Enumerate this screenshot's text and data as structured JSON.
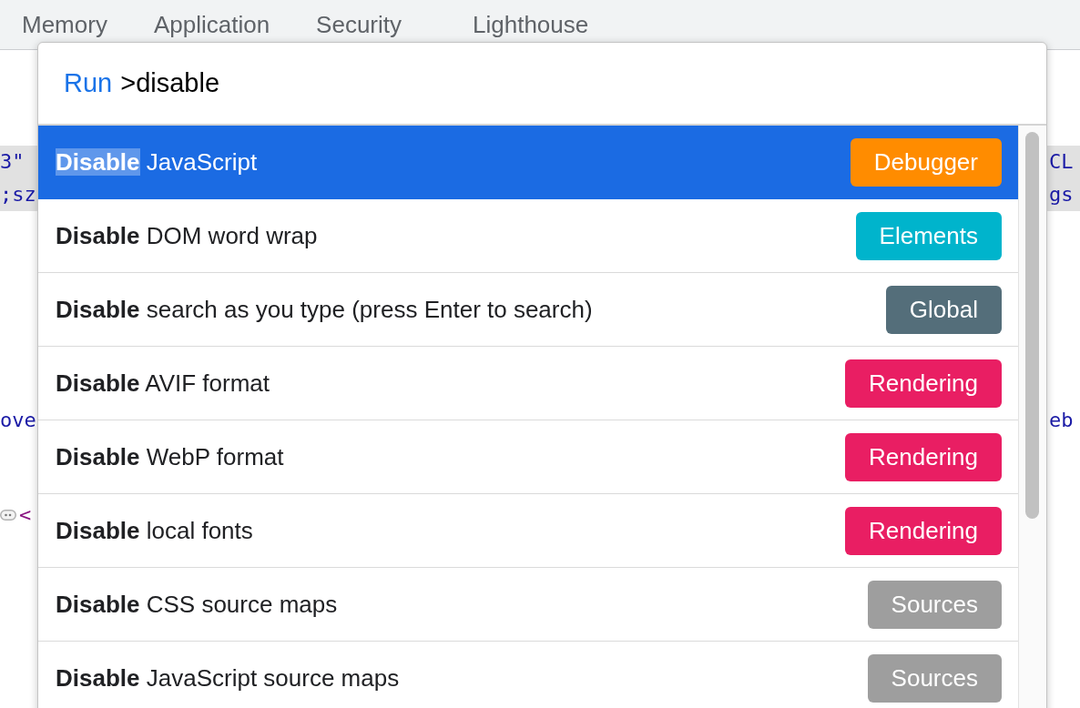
{
  "tabs": [
    {
      "label": "Memory"
    },
    {
      "label": "Application"
    },
    {
      "label": "Security"
    },
    {
      "label": "Lighthouse"
    }
  ],
  "code_lines": [
    {
      "left": "3\"",
      "right": "CL",
      "kind": "value",
      "highlighted": true,
      "collapsed": false
    },
    {
      "left": ";sz",
      "right": "gs",
      "kind": "value",
      "highlighted": true,
      "collapsed": false
    },
    {
      "left": "ove",
      "right": "eb",
      "kind": "value",
      "highlighted": false,
      "collapsed": false
    },
    {
      "left": "<",
      "kind": "tag",
      "highlighted": false,
      "collapsed": true
    }
  ],
  "palette": {
    "prompt": "Run",
    "query": ">disable",
    "commands": [
      {
        "match": "Disable",
        "text": "JavaScript",
        "category": "Debugger",
        "color": "#ff8c00",
        "selected": true
      },
      {
        "match": "Disable",
        "text": "DOM word wrap",
        "category": "Elements",
        "color": "#00b4cc",
        "selected": false
      },
      {
        "match": "Disable",
        "text": "search as you type (press Enter to search)",
        "category": "Global",
        "color": "#546e7a",
        "selected": false
      },
      {
        "match": "Disable",
        "text": "AVIF format",
        "category": "Rendering",
        "color": "#e91e63",
        "selected": false
      },
      {
        "match": "Disable",
        "text": "WebP format",
        "category": "Rendering",
        "color": "#e91e63",
        "selected": false
      },
      {
        "match": "Disable",
        "text": "local fonts",
        "category": "Rendering",
        "color": "#e91e63",
        "selected": false
      },
      {
        "match": "Disable",
        "text": "CSS source maps",
        "category": "Sources",
        "color": "#9e9e9e",
        "selected": false
      },
      {
        "match": "Disable",
        "text": "JavaScript source maps",
        "category": "Sources",
        "color": "#9e9e9e",
        "selected": false
      }
    ]
  }
}
